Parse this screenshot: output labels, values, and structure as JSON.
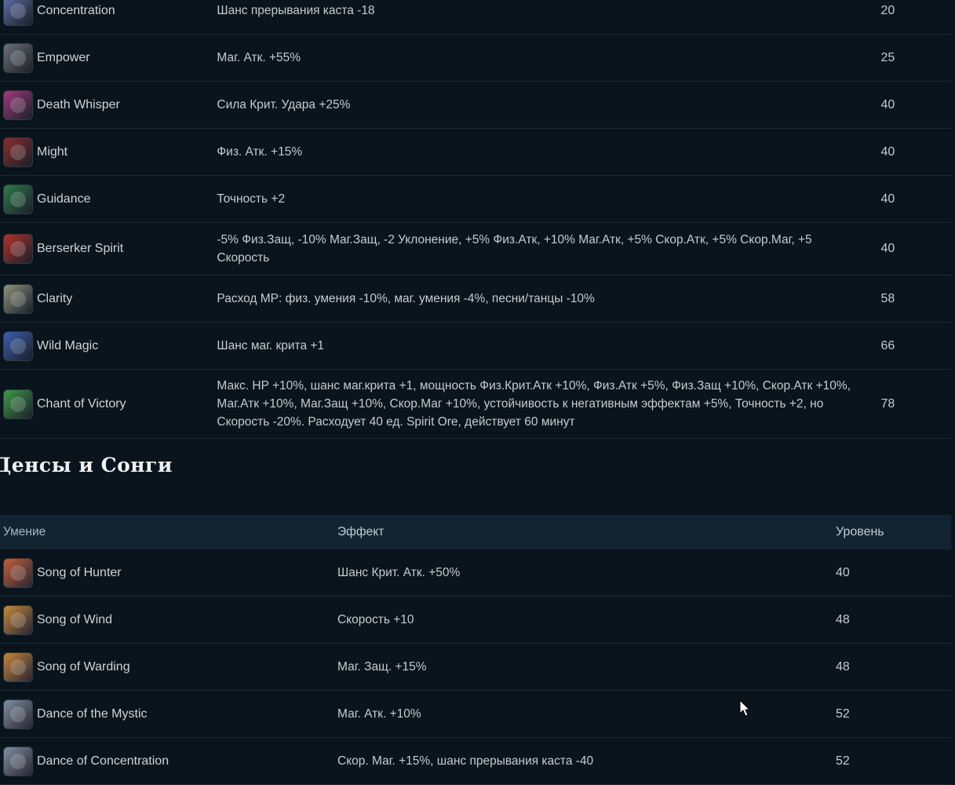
{
  "top_table": {
    "rows": [
      {
        "name": "Concentration",
        "effect": "Шанс прерывания каста -18",
        "level": "20",
        "icon": "concentration-icon",
        "color": "#5b6fa8"
      },
      {
        "name": "Empower",
        "effect": "Маг. Атк. +55%",
        "level": "25",
        "icon": "empower-icon",
        "color": "#6b6f78"
      },
      {
        "name": "Death Whisper",
        "effect": "Сила Крит. Удара +25%",
        "level": "40",
        "icon": "death-whisper-icon",
        "color": "#a03b7a"
      },
      {
        "name": "Might",
        "effect": "Физ. Атк. +15%",
        "level": "40",
        "icon": "might-icon",
        "color": "#8a2f2f"
      },
      {
        "name": "Guidance",
        "effect": "Точность +2",
        "level": "40",
        "icon": "guidance-icon",
        "color": "#2f7a4a"
      },
      {
        "name": "Berserker Spirit",
        "effect": "-5% Физ.Защ, -10% Маг.Защ, -2 Уклонение, +5% Физ.Атк, +10% Маг.Атк, +5% Скор.Атк, +5% Скор.Маг, +5 Скорость",
        "level": "40",
        "icon": "berserker-spirit-icon",
        "color": "#b3322a"
      },
      {
        "name": "Clarity",
        "effect": "Расход MP: физ. умения -10%, маг. умения -4%, песни/танцы -10%",
        "level": "58",
        "icon": "clarity-icon",
        "color": "#8f937c"
      },
      {
        "name": "Wild Magic",
        "effect": "Шанс маг. крита +1",
        "level": "66",
        "icon": "wild-magic-icon",
        "color": "#3d5fb0"
      },
      {
        "name": "Chant of Victory",
        "effect": "Макс. HP +10%, шанс маг.крита +1, мощность Физ.Крит.Атк +10%, Физ.Атк +5%, Физ.Защ +10%, Скор.Атк +10%, Маг.Атк +10%, Маг.Защ +10%, Скор.Маг +10%, устойчивость к негативным эффектам +5%, Точность +2, но Скорость -20%. Расходует 40 ед. Spirit Ore, действует 60 минут",
        "level": "78",
        "icon": "chant-of-victory-icon",
        "color": "#3e9a4a"
      }
    ]
  },
  "section": {
    "title": "Денсы и Сонги"
  },
  "dance_table": {
    "headers": {
      "skill": "Умение",
      "effect": "Эффект",
      "level": "Уровень"
    },
    "rows": [
      {
        "name": "Song of Hunter",
        "effect": "Шанс Крит. Атк. +50%",
        "level": "40",
        "icon": "song-of-hunter-icon",
        "color": "#c0603a"
      },
      {
        "name": "Song of Wind",
        "effect": "Скорость +10",
        "level": "48",
        "icon": "song-of-wind-icon",
        "color": "#c48a3a"
      },
      {
        "name": "Song of Warding",
        "effect": "Маг. Защ. +15%",
        "level": "48",
        "icon": "song-of-warding-icon",
        "color": "#c4863c"
      },
      {
        "name": "Dance of the Mystic",
        "effect": "Маг. Атк. +10%",
        "level": "52",
        "icon": "dance-of-the-mystic-icon",
        "color": "#7d8fa4"
      },
      {
        "name": "Dance of Concentration",
        "effect": "Скор. Маг. +15%, шанс прерывания каста -40",
        "level": "52",
        "icon": "dance-of-concentration-icon",
        "color": "#7e8ea2"
      }
    ]
  }
}
